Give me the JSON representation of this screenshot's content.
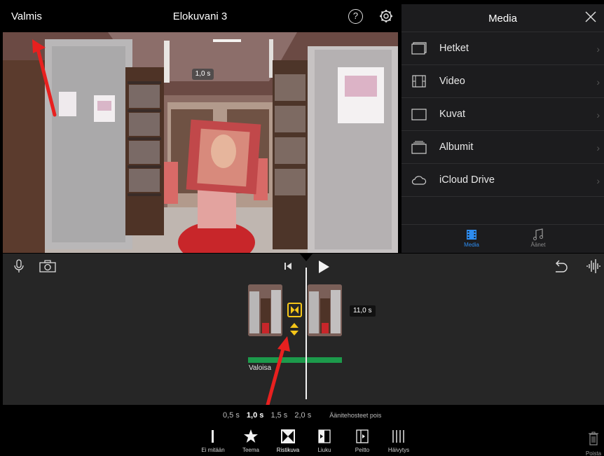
{
  "topbar": {
    "done_label": "Valmis",
    "project_title": "Elokuvani 3",
    "help_glyph": "?",
    "settings_icon": "gear-icon"
  },
  "preview": {
    "time_badge": "1,0 s",
    "annotation_color": "#e8201f"
  },
  "media_panel": {
    "title": "Media",
    "close_icon": "close-icon",
    "items": [
      {
        "label": "Hetket",
        "icon": "moments-icon"
      },
      {
        "label": "Video",
        "icon": "film-icon"
      },
      {
        "label": "Kuvat",
        "icon": "photo-icon"
      },
      {
        "label": "Albumit",
        "icon": "albums-icon"
      },
      {
        "label": "iCloud Drive",
        "icon": "cloud-icon"
      }
    ],
    "tabs": [
      {
        "label": "Media",
        "icon": "media-icon",
        "active": true
      },
      {
        "label": "Äänet",
        "icon": "music-note-icon",
        "active": false
      }
    ],
    "accent_color": "#2d8cf0"
  },
  "timeline": {
    "clip_duration": "11,0 s",
    "audio_label": "Valoisa",
    "audio_color": "#1c9a4b",
    "transition_color": "#f5c518",
    "icons": [
      "microphone-icon",
      "camera-icon",
      "skip-to-start-icon",
      "play-icon",
      "undo-icon",
      "waveform-icon"
    ]
  },
  "transition_editor": {
    "durations": [
      {
        "label": "0,5 s",
        "selected": false
      },
      {
        "label": "1,0 s",
        "selected": true
      },
      {
        "label": "1,5 s",
        "selected": false
      },
      {
        "label": "2,0 s",
        "selected": false
      }
    ],
    "sound_effects_label": "Äänitehosteet pois",
    "tools": [
      {
        "label": "Ei mitään",
        "icon": "none-icon"
      },
      {
        "label": "Teema",
        "icon": "star-icon"
      },
      {
        "label": "Ristikuva",
        "icon": "cross-dissolve-icon",
        "active": true
      },
      {
        "label": "Liuku",
        "icon": "slide-icon"
      },
      {
        "label": "Peitto",
        "icon": "wipe-icon"
      },
      {
        "label": "Häivytys",
        "icon": "fade-icon"
      }
    ],
    "delete_label": "Poista"
  }
}
